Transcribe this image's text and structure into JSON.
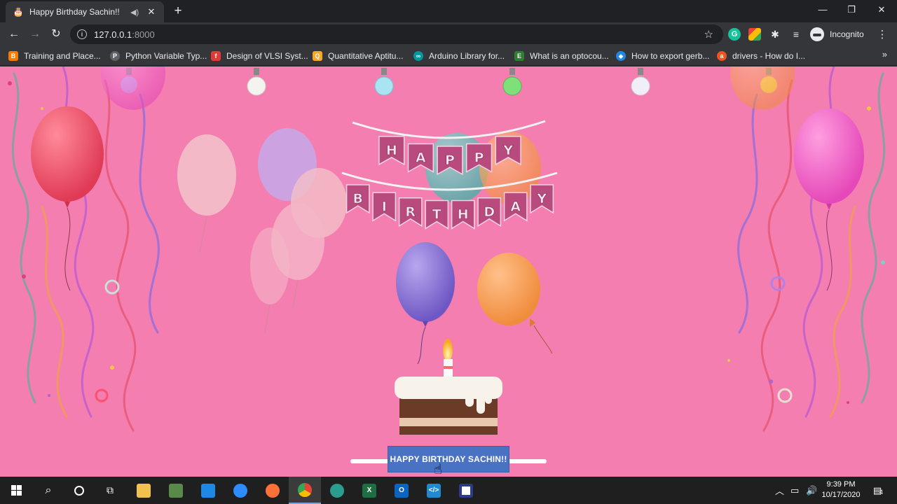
{
  "browser": {
    "tab": {
      "title": "Happy Birthday Sachin!!",
      "favicon": "cake-icon",
      "audio_icon": "speaker-icon"
    },
    "window_controls": {
      "minimize": "—",
      "maximize": "❐",
      "close": "✕"
    },
    "address": {
      "host": "127.0.0.1",
      "port": ":8000"
    },
    "profile_label": "Incognito",
    "bookmarks": [
      {
        "label": "Training and Place...",
        "icon": "blogger-icon",
        "color": "#f57c00"
      },
      {
        "label": "Python Variable Typ...",
        "icon": "python-icon",
        "color": "#5f6368"
      },
      {
        "label": "Design of VLSI Syst...",
        "icon": "flash-icon",
        "color": "#e53935"
      },
      {
        "label": "Quantitative Aptitu...",
        "icon": "aptitude-icon",
        "color": "#f9a825"
      },
      {
        "label": "Arduino Library for...",
        "icon": "arduino-icon",
        "color": "#00979d"
      },
      {
        "label": "What is an optocou...",
        "icon": "page-icon",
        "color": "#2e7d32"
      },
      {
        "label": "How to export gerb...",
        "icon": "compass-icon",
        "color": "#1e88e5"
      },
      {
        "label": "drivers - How do I...",
        "icon": "askubuntu-icon",
        "color": "#e95420"
      }
    ]
  },
  "page": {
    "banner_line1": [
      "H",
      "A",
      "P",
      "P",
      "Y"
    ],
    "banner_line2": [
      "B",
      "I",
      "R",
      "T",
      "H",
      "D",
      "A",
      "Y"
    ],
    "button_label": "HAPPY BIRTHDAY SACHIN!!",
    "colors": {
      "background": "#f47eb0",
      "button": "#4a72c2"
    }
  },
  "taskbar": {
    "time": "9:39 PM",
    "date": "10/17/2020",
    "notification_count": "4"
  }
}
